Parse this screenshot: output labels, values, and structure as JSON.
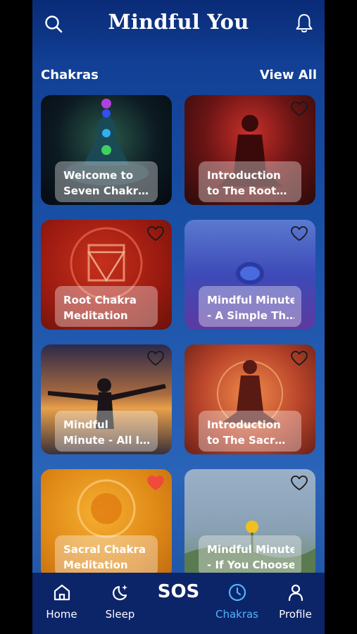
{
  "header": {
    "title": "Mindful You"
  },
  "section": {
    "title": "Chakras",
    "view_all": "View All"
  },
  "cards": [
    {
      "line1": "Welcome to",
      "line2": "Seven Chakr…",
      "favorite": false,
      "heart_shown": false
    },
    {
      "line1": "Introduction",
      "line2": "to The Root…",
      "favorite": false,
      "heart_shown": true
    },
    {
      "line1": "Root Chakra",
      "line2": "Meditation",
      "favorite": false,
      "heart_shown": true
    },
    {
      "line1": "Mindful Minute",
      "line2": "- A Simple Th…",
      "favorite": false,
      "heart_shown": true
    },
    {
      "line1": "Mindful",
      "line2": "Minute - All I…",
      "favorite": false,
      "heart_shown": true
    },
    {
      "line1": "Introduction",
      "line2": "to The Sacr…",
      "favorite": false,
      "heart_shown": true
    },
    {
      "line1": "Sacral Chakra",
      "line2": "Meditation",
      "favorite": true,
      "heart_shown": true
    },
    {
      "line1": "Mindful Minute",
      "line2": "- If You Choose",
      "favorite": false,
      "heart_shown": true
    }
  ],
  "nav": {
    "home": "Home",
    "sleep": "Sleep",
    "sos": "SOS",
    "chakras": "Chakras",
    "profile": "Profile",
    "active": "chakras"
  },
  "colors": {
    "accent": "#4fb4ff",
    "favorite": "#f04a3a",
    "nav_bg": "#0c2468"
  }
}
